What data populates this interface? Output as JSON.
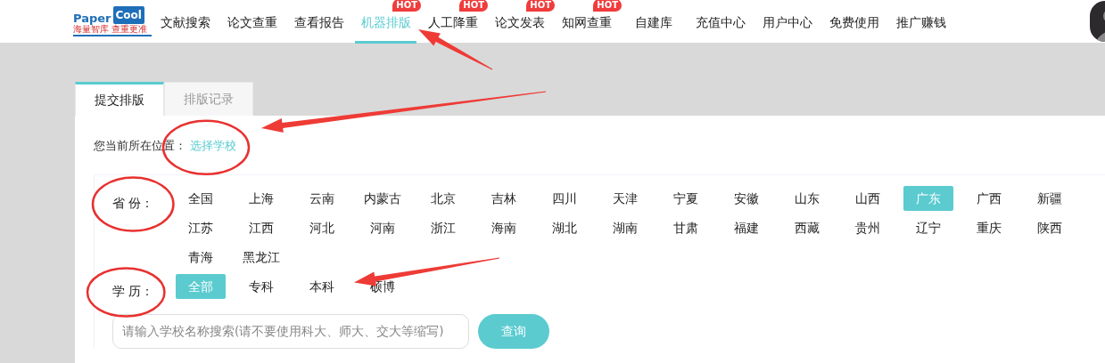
{
  "logo": {
    "word": "Paper",
    "badge_word": "Cool",
    "tagline": "海量智库 查重更准"
  },
  "nav": [
    {
      "label": "文献搜索",
      "selected": false
    },
    {
      "label": "论文查重",
      "selected": false
    },
    {
      "label": "查看报告",
      "selected": false
    },
    {
      "label": "机器排版",
      "selected": true,
      "badge": "HOT"
    },
    {
      "label": "人工降重",
      "selected": false,
      "badge": "HOT"
    },
    {
      "label": "论文发表",
      "selected": false,
      "badge": "HOT"
    },
    {
      "label": "知网查重",
      "selected": false,
      "badge": "HOT"
    },
    {
      "label": "自建库",
      "selected": false
    },
    {
      "label": "充值中心",
      "selected": false
    },
    {
      "label": "用户中心",
      "selected": false
    },
    {
      "label": "免费使用",
      "selected": false
    },
    {
      "label": "推广赚钱",
      "selected": false
    }
  ],
  "tabs": [
    {
      "label": "提交排版",
      "selected": true
    },
    {
      "label": "排版记录",
      "selected": false
    }
  ],
  "breadcrumb": {
    "label": "您当前所在位置：",
    "link": "选择学校"
  },
  "filters": [
    {
      "label": "省 份：",
      "options": [
        {
          "label": "全国",
          "selected": false
        },
        {
          "label": "上海",
          "selected": false
        },
        {
          "label": "云南",
          "selected": false
        },
        {
          "label": "内蒙古",
          "selected": false
        },
        {
          "label": "北京",
          "selected": false
        },
        {
          "label": "吉林",
          "selected": false
        },
        {
          "label": "四川",
          "selected": false
        },
        {
          "label": "天津",
          "selected": false
        },
        {
          "label": "宁夏",
          "selected": false
        },
        {
          "label": "安徽",
          "selected": false
        },
        {
          "label": "山东",
          "selected": false
        },
        {
          "label": "山西",
          "selected": false
        },
        {
          "label": "广东",
          "selected": true
        },
        {
          "label": "广西",
          "selected": false
        },
        {
          "label": "新疆",
          "selected": false
        },
        {
          "label": "江苏",
          "selected": false
        },
        {
          "label": "江西",
          "selected": false
        },
        {
          "label": "河北",
          "selected": false
        },
        {
          "label": "河南",
          "selected": false
        },
        {
          "label": "浙江",
          "selected": false
        },
        {
          "label": "海南",
          "selected": false
        },
        {
          "label": "湖北",
          "selected": false
        },
        {
          "label": "湖南",
          "selected": false
        },
        {
          "label": "甘肃",
          "selected": false
        },
        {
          "label": "福建",
          "selected": false
        },
        {
          "label": "西藏",
          "selected": false
        },
        {
          "label": "贵州",
          "selected": false
        },
        {
          "label": "辽宁",
          "selected": false
        },
        {
          "label": "重庆",
          "selected": false
        },
        {
          "label": "陕西",
          "selected": false
        },
        {
          "label": "青海",
          "selected": false
        },
        {
          "label": "黑龙江",
          "selected": false
        }
      ]
    },
    {
      "label": "学 历：",
      "options": [
        {
          "label": "全部",
          "selected": true
        },
        {
          "label": "专科",
          "selected": false
        },
        {
          "label": "本科",
          "selected": false
        },
        {
          "label": "硕博",
          "selected": false
        }
      ]
    }
  ],
  "search": {
    "placeholder": "请输入学校名称搜索(请不要使用科大、师大、交大等缩写)",
    "button": "查询"
  }
}
